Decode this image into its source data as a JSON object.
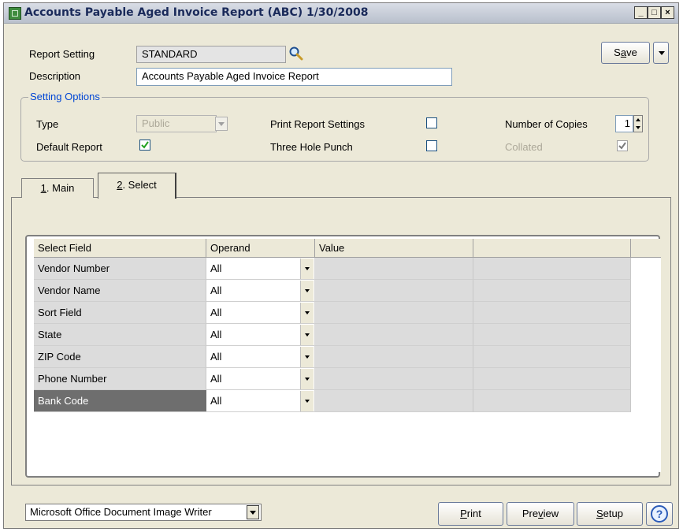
{
  "window": {
    "title": "Accounts Payable Aged Invoice Report (ABC) 1/30/2008",
    "minimize": "_",
    "maximize": "□",
    "close": "×"
  },
  "report_setting": {
    "label": "Report Setting",
    "value": "STANDARD"
  },
  "description": {
    "label": "Description",
    "value": "Accounts Payable Aged Invoice Report"
  },
  "save": {
    "label": "Save",
    "accel": "a"
  },
  "setting_options": {
    "title": "Setting Options",
    "type_label": "Type",
    "type_value": "Public",
    "default_report_label": "Default Report",
    "default_report_checked": true,
    "print_report_settings_label": "Print Report Settings",
    "print_report_settings_checked": false,
    "three_hole_punch_label": "Three Hole Punch",
    "three_hole_punch_checked": false,
    "number_of_copies_label": "Number of Copies",
    "number_of_copies_value": "1",
    "collated_label": "Collated",
    "collated_checked": true
  },
  "tabs": [
    {
      "key": "1",
      "label": ". Main",
      "active": false
    },
    {
      "key": "2",
      "label": ". Select",
      "active": true
    }
  ],
  "grid": {
    "columns": [
      "Select Field",
      "Operand",
      "Value",
      ""
    ],
    "rows": [
      {
        "field": "Vendor Number",
        "operand": "All",
        "value": ""
      },
      {
        "field": "Vendor Name",
        "operand": "All",
        "value": ""
      },
      {
        "field": "Sort Field",
        "operand": "All",
        "value": ""
      },
      {
        "field": "State",
        "operand": "All",
        "value": ""
      },
      {
        "field": "ZIP Code",
        "operand": "All",
        "value": ""
      },
      {
        "field": "Phone Number",
        "operand": "All",
        "value": ""
      },
      {
        "field": "Bank Code",
        "operand": "All",
        "value": "",
        "selected": true
      }
    ]
  },
  "printer": {
    "value": "Microsoft Office Document Image Writer"
  },
  "buttons": {
    "print": {
      "label": "Print",
      "accel_index": 0
    },
    "preview": {
      "label": "Preview",
      "accel_index": 3
    },
    "setup": {
      "label": "Setup",
      "accel_index": 0
    },
    "help": "?"
  },
  "icons": {
    "app": "app-green-icon",
    "lookup": "magnifier-icon",
    "save_menu": "triangle-down-icon",
    "help": "help-icon"
  }
}
